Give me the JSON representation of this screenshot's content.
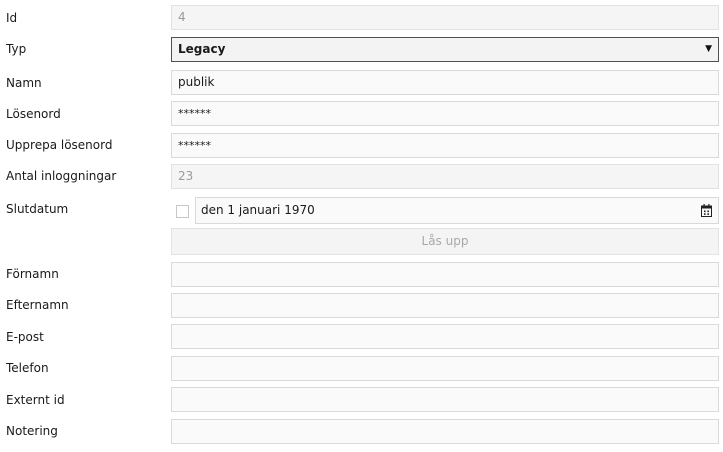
{
  "fields": {
    "id": {
      "label": "Id",
      "value": "4"
    },
    "typ": {
      "label": "Typ",
      "value": "Legacy"
    },
    "namn": {
      "label": "Namn",
      "value": "publik"
    },
    "losenord": {
      "label": "Lösenord",
      "value": "******"
    },
    "upprepa": {
      "label": "Upprepa lösenord",
      "value": "******"
    },
    "antal": {
      "label": "Antal inloggningar",
      "value": "23"
    },
    "slutdatum": {
      "label": "Slutdatum",
      "value": "den 1 januari 1970",
      "checked": false
    },
    "fornamn": {
      "label": "Förnamn",
      "value": ""
    },
    "efternamn": {
      "label": "Efternamn",
      "value": ""
    },
    "epost": {
      "label": "E-post",
      "value": ""
    },
    "telefon": {
      "label": "Telefon",
      "value": ""
    },
    "externt": {
      "label": "Externt id",
      "value": ""
    },
    "notering": {
      "label": "Notering",
      "value": ""
    }
  },
  "unlock_button": {
    "label": "Lås upp"
  },
  "icons": {
    "dropdown": "chevron-down-icon",
    "calendar": "calendar-icon"
  }
}
